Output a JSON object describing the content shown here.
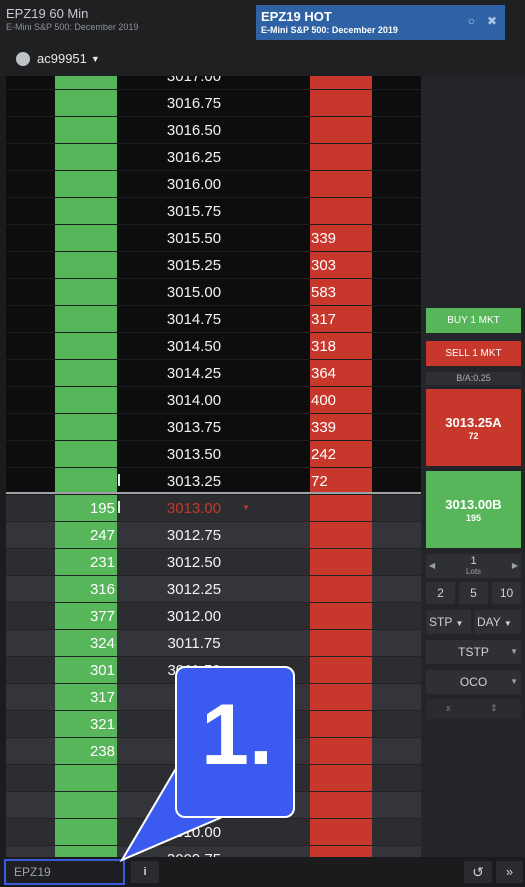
{
  "tabs": [
    {
      "title": "EPZ19 60 Min",
      "subtitle": "E-Mini S&P 500: December 2019"
    },
    {
      "title": "EPZ19 HOT",
      "subtitle": "E-Mini S&P 500: December 2019"
    }
  ],
  "account": {
    "name": "ac99951"
  },
  "ladder": [
    {
      "price": "3017.00",
      "bid": "",
      "ask": ""
    },
    {
      "price": "3016.75",
      "bid": "",
      "ask": ""
    },
    {
      "price": "3016.50",
      "bid": "",
      "ask": ""
    },
    {
      "price": "3016.25",
      "bid": "",
      "ask": ""
    },
    {
      "price": "3016.00",
      "bid": "",
      "ask": ""
    },
    {
      "price": "3015.75",
      "bid": "",
      "ask": ""
    },
    {
      "price": "3015.50",
      "bid": "",
      "ask": "339"
    },
    {
      "price": "3015.25",
      "bid": "",
      "ask": "303"
    },
    {
      "price": "3015.00",
      "bid": "",
      "ask": "583"
    },
    {
      "price": "3014.75",
      "bid": "",
      "ask": "317"
    },
    {
      "price": "3014.50",
      "bid": "",
      "ask": "318"
    },
    {
      "price": "3014.25",
      "bid": "",
      "ask": "364"
    },
    {
      "price": "3014.00",
      "bid": "",
      "ask": "400"
    },
    {
      "price": "3013.75",
      "bid": "",
      "ask": "339"
    },
    {
      "price": "3013.50",
      "bid": "",
      "ask": "242"
    },
    {
      "price": "3013.25",
      "bid": "",
      "ask": "72"
    },
    {
      "price": "3013.00",
      "bid": "195",
      "ask": "",
      "last": true
    },
    {
      "price": "3012.75",
      "bid": "247",
      "ask": ""
    },
    {
      "price": "3012.50",
      "bid": "231",
      "ask": ""
    },
    {
      "price": "3012.25",
      "bid": "316",
      "ask": ""
    },
    {
      "price": "3012.00",
      "bid": "377",
      "ask": ""
    },
    {
      "price": "3011.75",
      "bid": "324",
      "ask": ""
    },
    {
      "price": "3011.50",
      "bid": "301",
      "ask": ""
    },
    {
      "price": "",
      "bid": "317",
      "ask": ""
    },
    {
      "price": "",
      "bid": "321",
      "ask": ""
    },
    {
      "price": "",
      "bid": "238",
      "ask": ""
    },
    {
      "price": "",
      "bid": "",
      "ask": ""
    },
    {
      "price": "",
      "bid": "",
      "ask": ""
    },
    {
      "price": "3010.00",
      "bid": "",
      "ask": ""
    },
    {
      "price": "3009.75",
      "bid": "",
      "ask": ""
    }
  ],
  "panel": {
    "buy_label": "BUY 1 MKT",
    "sell_label": "SELL 1 MKT",
    "spread": "B/A:0.25",
    "ask_price": "3013.25A",
    "ask_size": "72",
    "bid_price": "3013.00B",
    "bid_size": "195",
    "lots_value": "1",
    "lots_label": "Lots",
    "qty": [
      "2",
      "5",
      "10"
    ],
    "order_type": "STP",
    "duration": "DAY",
    "bracket": "TSTP",
    "oco": "OCO",
    "x_label": "x"
  },
  "bottom": {
    "symbol": "EPZ19"
  },
  "callout": {
    "label": "1."
  },
  "colors": {
    "bid": "#57b55a",
    "ask": "#c8372b",
    "accent": "#3b5bf0",
    "tab_active": "#2f62a4"
  }
}
